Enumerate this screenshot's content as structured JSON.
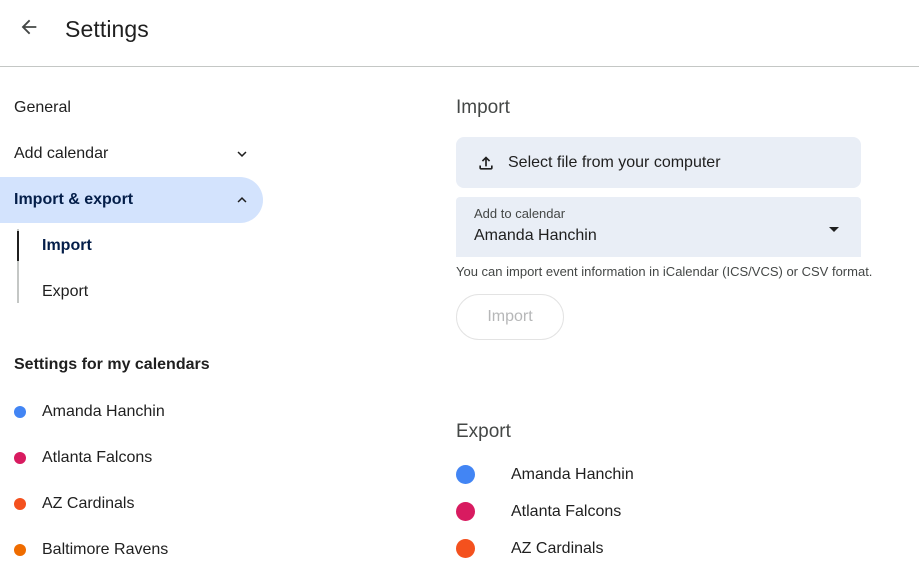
{
  "header": {
    "title": "Settings",
    "back_icon": "arrow-back-icon"
  },
  "sidebar": {
    "general": "General",
    "add_calendar": "Add calendar",
    "import_export": "Import & export",
    "import_export_sub": [
      "Import",
      "Export"
    ],
    "my_calendars_label": "Settings for my calendars",
    "calendars": [
      {
        "name": "Amanda Hanchin",
        "color": "#4285f4"
      },
      {
        "name": "Atlanta Falcons",
        "color": "#d81b60"
      },
      {
        "name": "AZ Cardinals",
        "color": "#f4511e"
      },
      {
        "name": "Baltimore Ravens",
        "color": "#ef6c00"
      }
    ]
  },
  "main": {
    "import": {
      "heading": "Import",
      "select_file": "Select file from your computer",
      "add_to_calendar_label": "Add to calendar",
      "add_to_calendar_value": "Amanda Hanchin",
      "help": "You can import event information in iCalendar (ICS/VCS) or CSV format.",
      "import_button": "Import"
    },
    "export": {
      "heading": "Export",
      "calendars": [
        {
          "name": "Amanda Hanchin",
          "color": "#4285f4"
        },
        {
          "name": "Atlanta Falcons",
          "color": "#d81b60"
        },
        {
          "name": "AZ Cardinals",
          "color": "#f4511e"
        }
      ]
    }
  },
  "colors": {
    "accent_bg": "#d3e3fd",
    "surface": "#e9eef6"
  }
}
